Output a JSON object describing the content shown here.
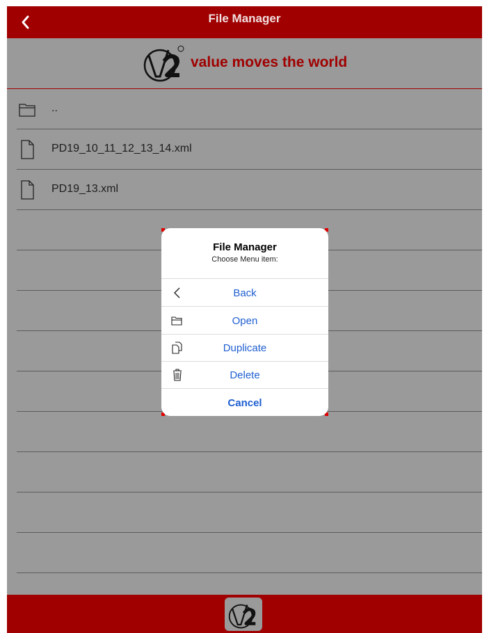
{
  "header": {
    "title": "File Manager"
  },
  "brand": {
    "tagline": "value moves the world",
    "accent_color": "#a00000"
  },
  "files": [
    {
      "name": "..",
      "icon": "folder-icon"
    },
    {
      "name": "PD19_10_11_12_13_14.xml",
      "icon": "file-icon"
    },
    {
      "name": "PD19_13.xml",
      "icon": "file-icon"
    }
  ],
  "dialog": {
    "title": "File Manager",
    "subtitle": "Choose Menu item:",
    "items": [
      {
        "label": "Back",
        "icon": "chevron-left-icon"
      },
      {
        "label": "Open",
        "icon": "folder-icon"
      },
      {
        "label": "Duplicate",
        "icon": "duplicate-icon"
      },
      {
        "label": "Delete",
        "icon": "trash-icon"
      }
    ],
    "cancel_label": "Cancel"
  }
}
